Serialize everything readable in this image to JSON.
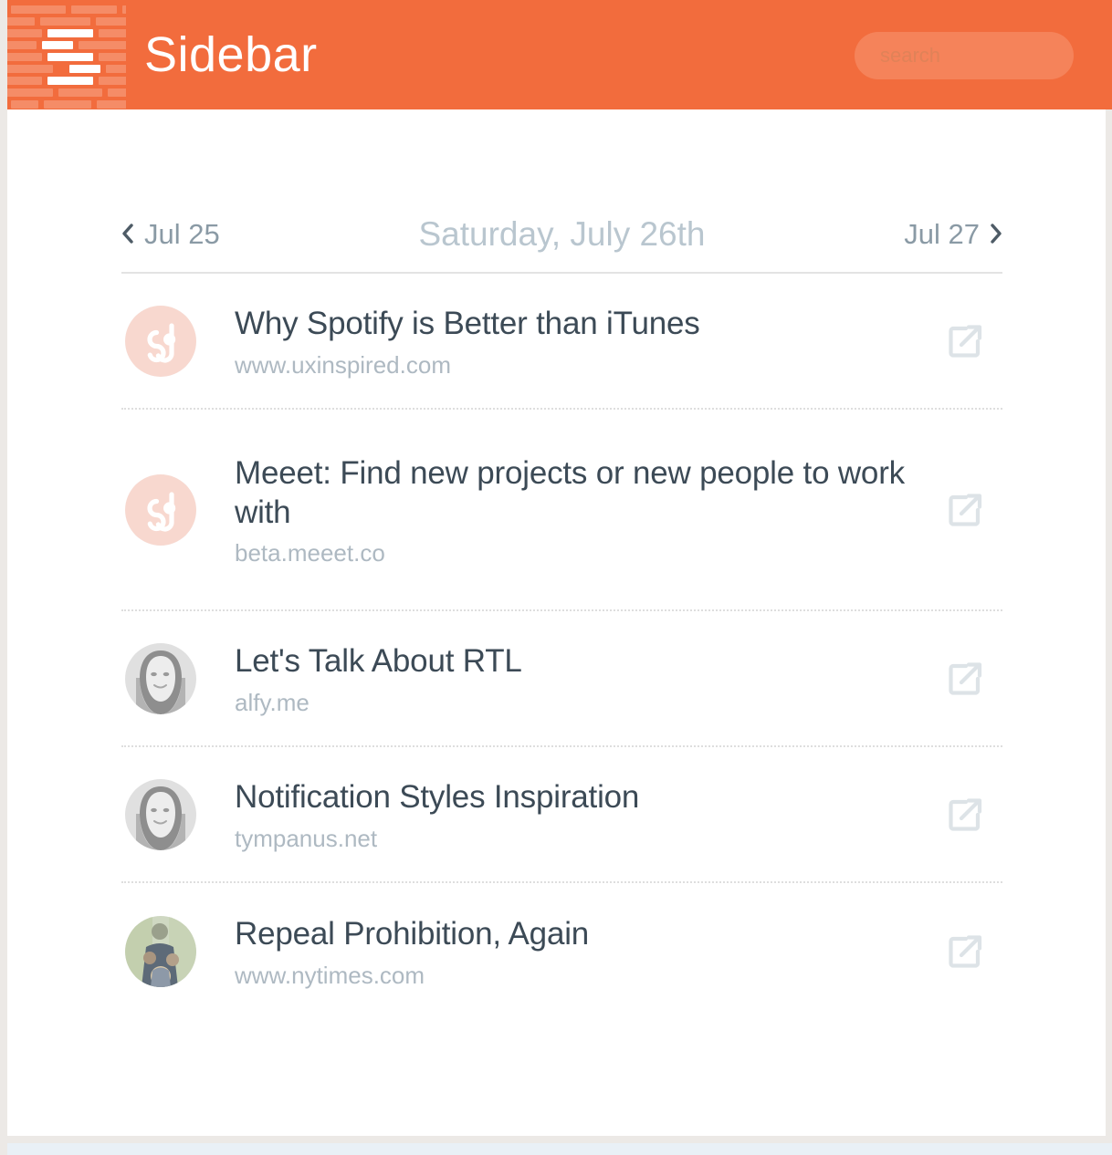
{
  "header": {
    "title": "Sidebar",
    "logo_icon": "brick-hamburger-logo",
    "brand_color": "#f26c3d",
    "search": {
      "placeholder": "search",
      "value": "",
      "icon": "search-field"
    }
  },
  "date_nav": {
    "prev_label": "Jul 25",
    "prev_icon": "chevron-left-icon",
    "current_label": "Saturday, July 26th",
    "next_label": "Jul 27",
    "next_icon": "chevron-right-icon"
  },
  "items": [
    {
      "title": "Why Spotify is Better than iTunes",
      "url": "www.uxinspired.com",
      "avatar": "sg-monogram-avatar",
      "avatar_color": "#f8d8cf",
      "open_icon": "external-link-icon"
    },
    {
      "title": "Meeet: Find new projects or new people to work with",
      "url": "beta.meeet.co",
      "avatar": "sg-monogram-avatar",
      "avatar_color": "#f8d8cf",
      "open_icon": "external-link-icon"
    },
    {
      "title": "Let's Talk About RTL",
      "url": "alfy.me",
      "avatar": "person-photo-avatar",
      "avatar_color": "#d8d8d8",
      "open_icon": "external-link-icon"
    },
    {
      "title": "Notification Styles Inspiration",
      "url": "tympanus.net",
      "avatar": "person-photo-avatar",
      "avatar_color": "#d8d8d8",
      "open_icon": "external-link-icon"
    },
    {
      "title": "Repeal Prohibition, Again",
      "url": "www.nytimes.com",
      "avatar": "family-photo-avatar",
      "avatar_color": "#d5dcc8",
      "open_icon": "external-link-icon"
    }
  ]
}
